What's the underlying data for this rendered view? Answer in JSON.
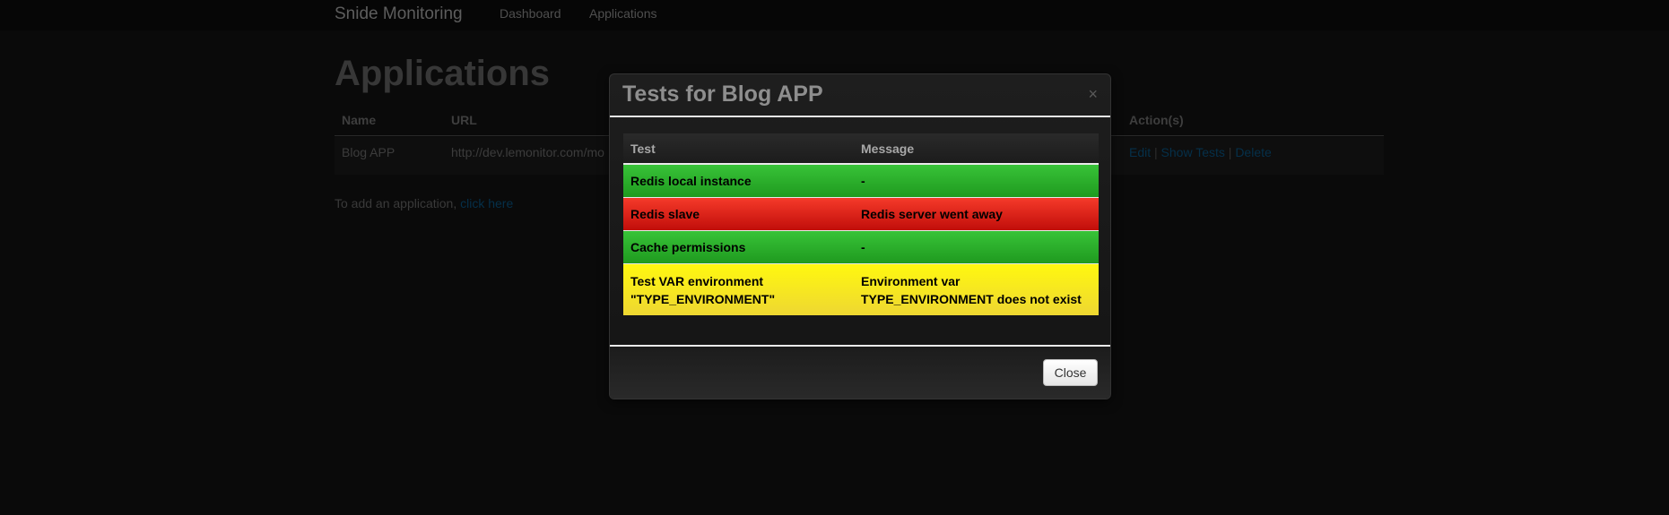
{
  "navbar": {
    "brand": "Snide Monitoring",
    "links": [
      "Dashboard",
      "Applications"
    ]
  },
  "page": {
    "title": "Applications",
    "table": {
      "headers": [
        "Name",
        "URL",
        "Action(s)"
      ],
      "row": {
        "name": "Blog APP",
        "url": "http://dev.lemonitor.com/mo",
        "actions": [
          "Edit",
          "Show Tests",
          "Delete"
        ],
        "separator": "|"
      }
    },
    "add_text": "To add an application,",
    "add_link": "click here"
  },
  "modal": {
    "title": "Tests for Blog APP",
    "close_x": "×",
    "headers": [
      "Test",
      "Message"
    ],
    "rows": [
      {
        "test": "Redis local instance",
        "message": "-",
        "status": "success",
        "color": "#2cb02c"
      },
      {
        "test": "Redis slave",
        "message": "Redis server went away",
        "status": "error",
        "color": "#dd2218"
      },
      {
        "test": "Cache permissions",
        "message": "-",
        "status": "success",
        "color": "#2cb02c"
      },
      {
        "test": "Test VAR environment \"TYPE_ENVIRONMENT\"",
        "message": "Environment var TYPE_ENVIRONMENT does not exist",
        "status": "warning",
        "color": "#f8ea1f"
      }
    ],
    "close_button": "Close"
  }
}
